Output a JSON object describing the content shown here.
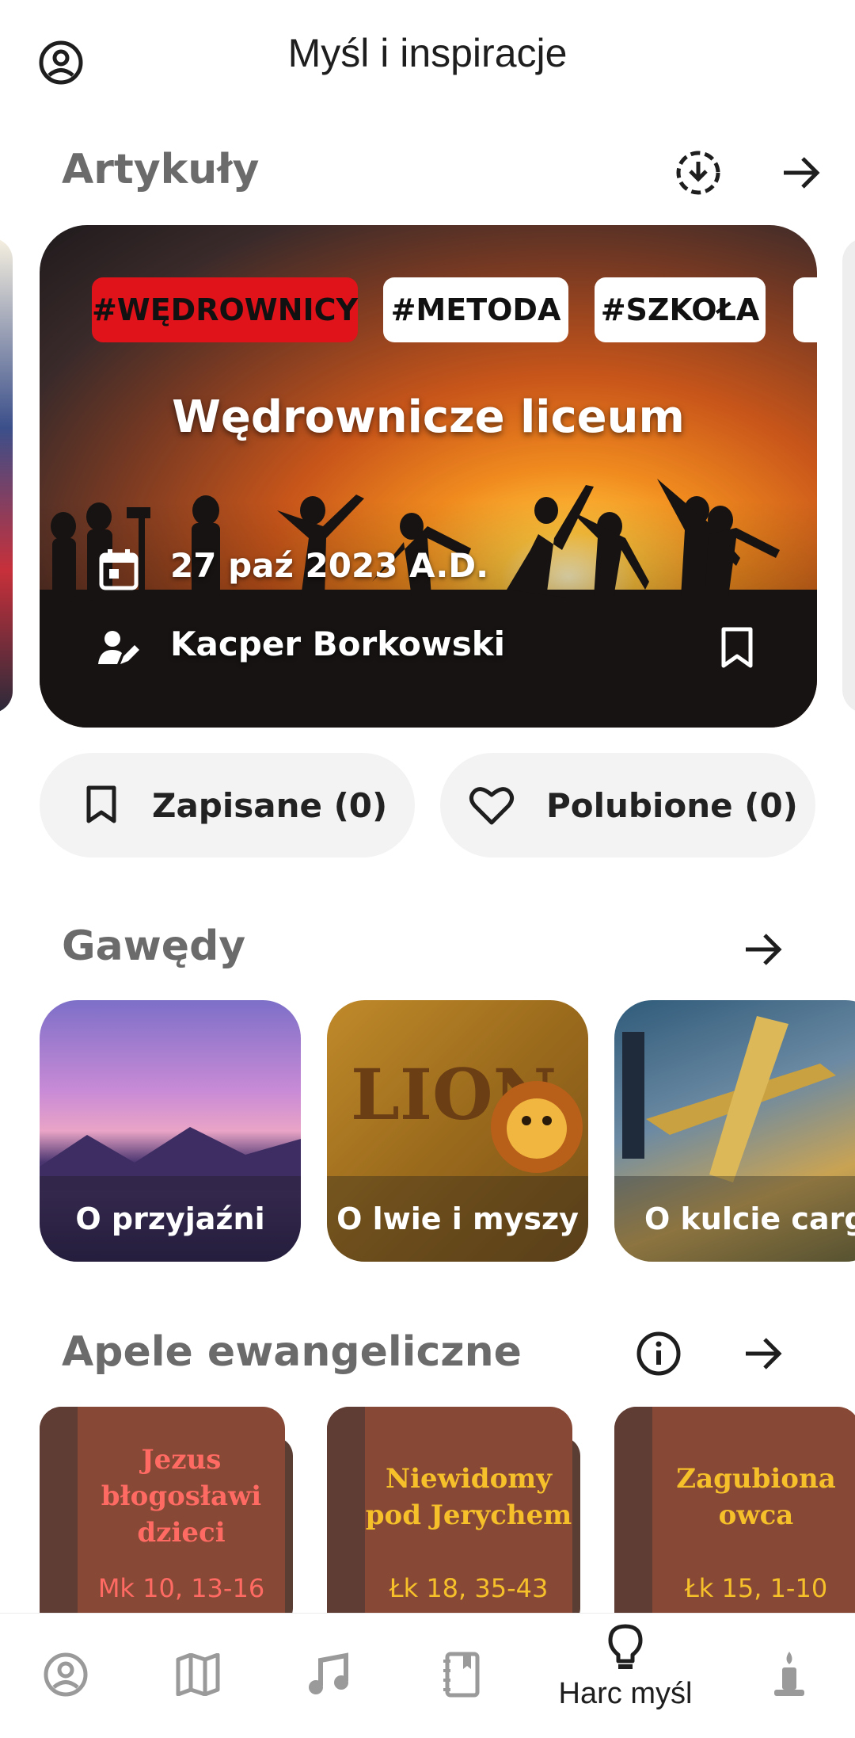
{
  "header": {
    "title": "Myśl i inspiracje"
  },
  "articles": {
    "section_title": "Artykuły",
    "featured": {
      "tags": [
        "#WĘDROWNICY",
        "#METODA",
        "#SZKOŁA"
      ],
      "title": "Wędrownicze liceum",
      "date": "27 paź 2023 A.D.",
      "author": "Kacper Borkowski"
    },
    "saved_label": "Zapisane (0)",
    "liked_label": "Polubione (0)"
  },
  "stories": {
    "section_title": "Gawędy",
    "items": [
      {
        "label": "O przyjaźni"
      },
      {
        "label": "O lwie i myszy"
      },
      {
        "label": "O kulcie cargo"
      }
    ]
  },
  "appeals": {
    "section_title": "Apele ewangeliczne",
    "items": [
      {
        "title_line1": "Jezus",
        "title_line2": "błogosławi",
        "title_line3": "dzieci",
        "ref": "Mk 10, 13-16",
        "title_color": "#ff6a63",
        "ref_color": "#ff6a63"
      },
      {
        "title_line1": "Niewidomy",
        "title_line2": "pod Jerychem",
        "title_line3": "",
        "ref": "Łk 18, 35-43",
        "title_color": "#f5c02a",
        "ref_color": "#f5c02a"
      },
      {
        "title_line1": "Zagubiona",
        "title_line2": "owca",
        "title_line3": "",
        "ref": "Łk 15, 1-10",
        "title_color": "#f5c02a",
        "ref_color": "#f5c02a"
      }
    ]
  },
  "bottom_nav": {
    "active_label": "Harc myśl"
  },
  "colors": {
    "accent_red": "#e0121a",
    "section_gray": "#6b6b6b",
    "book_brown": "#874836"
  }
}
